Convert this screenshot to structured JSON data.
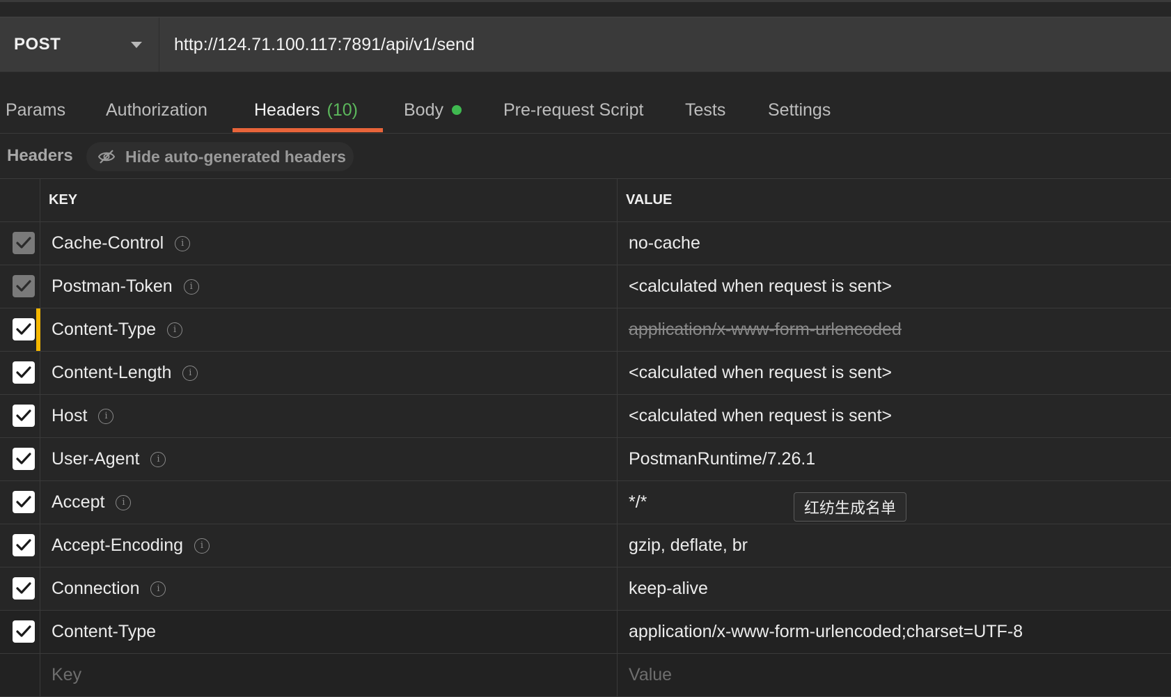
{
  "request": {
    "method": "POST",
    "url": "http://124.71.100.117:7891/api/v1/send"
  },
  "tabs": [
    {
      "label": "Params"
    },
    {
      "label": "Authorization"
    },
    {
      "label": "Headers",
      "count": "(10)",
      "active": true
    },
    {
      "label": "Body",
      "indicator": "green-dot"
    },
    {
      "label": "Pre-request Script"
    },
    {
      "label": "Tests"
    },
    {
      "label": "Settings"
    }
  ],
  "headers_section": {
    "title": "Headers",
    "hide_button_label": "Hide auto-generated headers",
    "hide_button_icon": "eye-slash-icon"
  },
  "table": {
    "key_header": "KEY",
    "value_header": "VALUE",
    "rows": [
      {
        "key": "Cache-Control",
        "value": "no-cache",
        "checked": true,
        "auto": true
      },
      {
        "key": "Postman-Token",
        "value": "<calculated when request is sent>",
        "checked": true,
        "auto": true
      },
      {
        "key": "Content-Type",
        "value": "application/x-www-form-urlencoded",
        "checked": true,
        "overridden": true
      },
      {
        "key": "Content-Length",
        "value": "<calculated when request is sent>",
        "checked": true
      },
      {
        "key": "Host",
        "value": "<calculated when request is sent>",
        "checked": true
      },
      {
        "key": "User-Agent",
        "value": "PostmanRuntime/7.26.1",
        "checked": true
      },
      {
        "key": "Accept",
        "value": "*/*",
        "checked": true
      },
      {
        "key": "Accept-Encoding",
        "value": "gzip, deflate, br",
        "checked": true
      },
      {
        "key": "Connection",
        "value": "keep-alive",
        "checked": true
      },
      {
        "key": "Content-Type",
        "value": "application/x-www-form-urlencoded;charset=UTF-8",
        "checked": true
      }
    ],
    "new_row": {
      "key_placeholder": "Key",
      "value_placeholder": "Value"
    }
  },
  "tooltip": {
    "text": "红纺生成名单"
  },
  "colors": {
    "accent_underline": "#e8643a",
    "count_green": "#5cb85c",
    "body_dot": "#3fb950",
    "override_marker": "#f5b700"
  }
}
